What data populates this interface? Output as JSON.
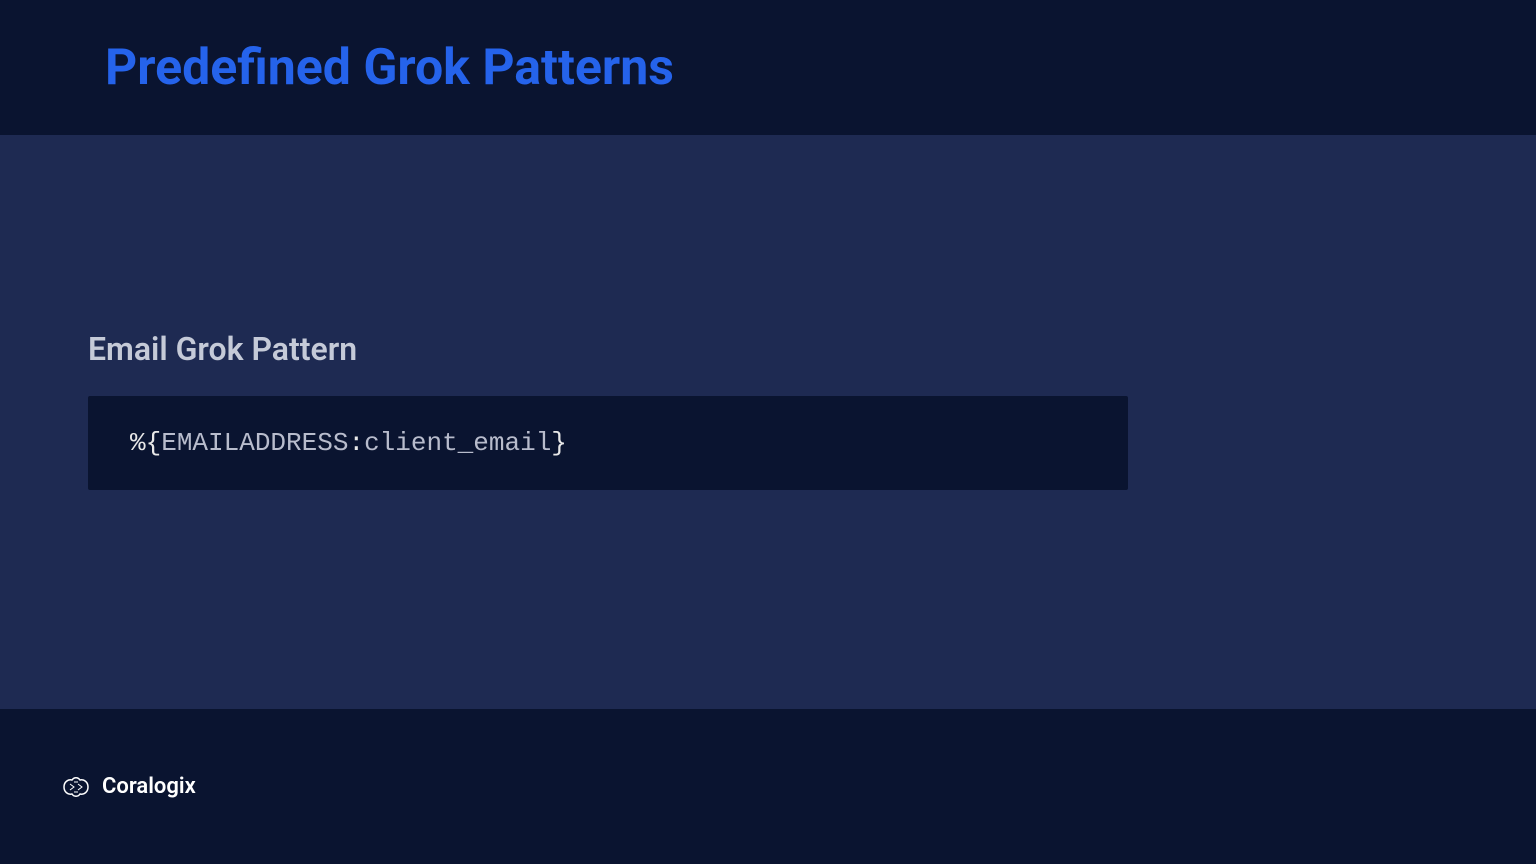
{
  "header": {
    "title": "Predefined Grok Patterns"
  },
  "content": {
    "section_title": "Email Grok Pattern",
    "code": {
      "prefix": "%{",
      "pattern": "EMAILADDRESS",
      "separator": ":",
      "field": "client_email",
      "suffix": "}"
    }
  },
  "footer": {
    "brand": "Coralogix"
  }
}
